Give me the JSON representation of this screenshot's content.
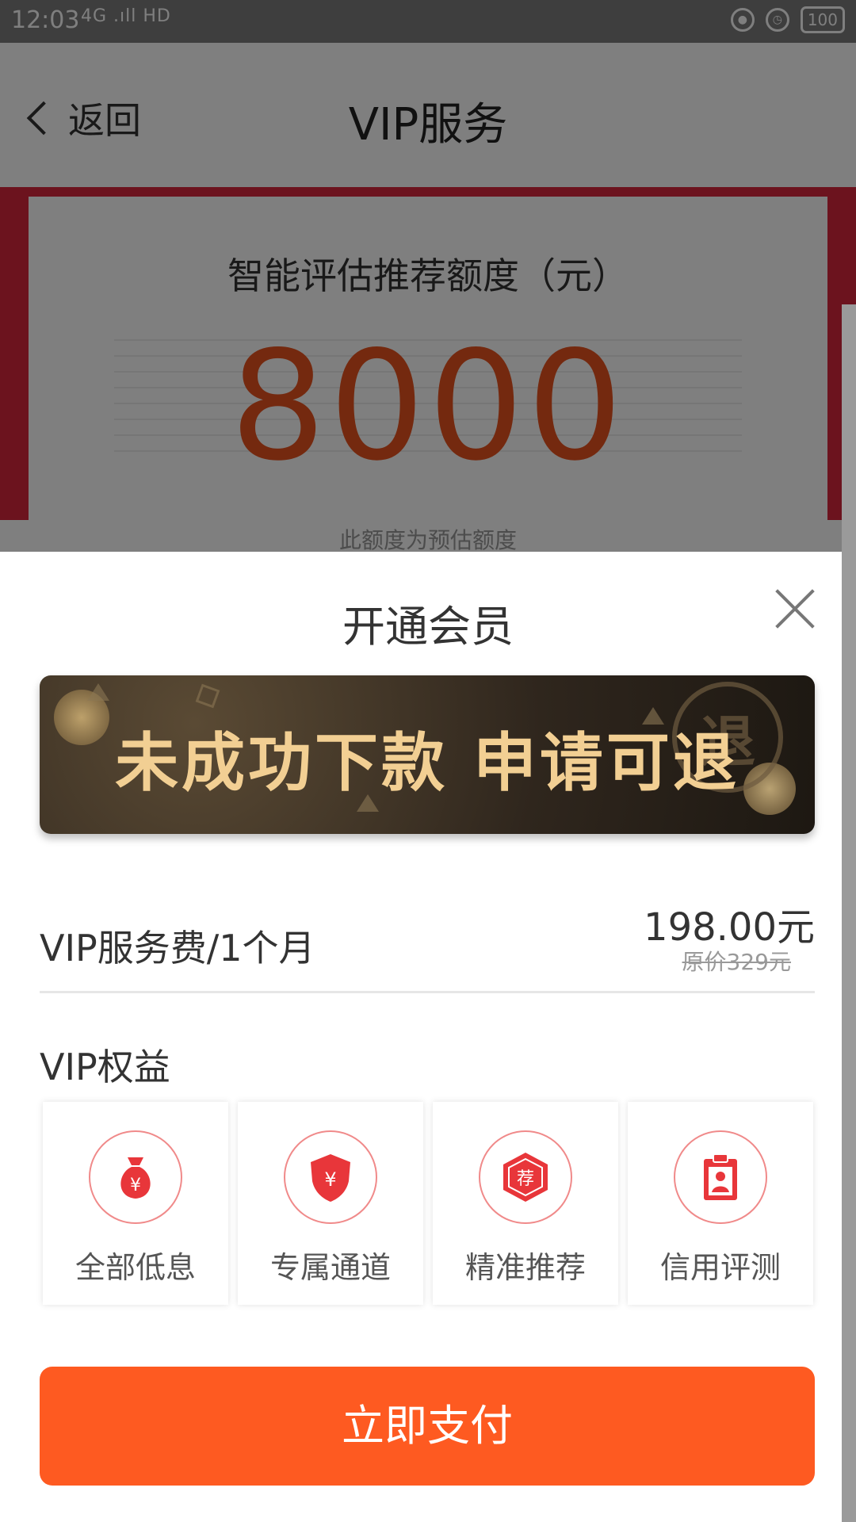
{
  "status_bar": {
    "time": "12:03",
    "signal": "4G .ıll HD",
    "battery": "100"
  },
  "nav": {
    "back_label": "返回",
    "title": "VIP服务"
  },
  "quota": {
    "title": "智能评估推荐额度（元）",
    "amount": "8000",
    "note": "此额度为预估额度"
  },
  "sheet": {
    "title": "开通会员",
    "banner_text": "未成功下款  申请可退",
    "banner_seal": "退",
    "fee": {
      "label": "VIP服务费/1个月",
      "price": "198.00元",
      "original_price": "原价329元"
    },
    "benefits_title": "VIP权益",
    "benefits": [
      {
        "label": "全部低息",
        "icon": "money-bag-icon"
      },
      {
        "label": "专属通道",
        "icon": "shield-yen-icon"
      },
      {
        "label": "精准推荐",
        "icon": "recommend-badge-icon"
      },
      {
        "label": "信用评测",
        "icon": "clipboard-user-icon"
      }
    ],
    "pay_label": "立即支付"
  },
  "colors": {
    "accent_orange": "#fe5a21",
    "brand_red": "#d8273c",
    "icon_red": "#e8363a",
    "banner_gold": "#f2cf93"
  }
}
